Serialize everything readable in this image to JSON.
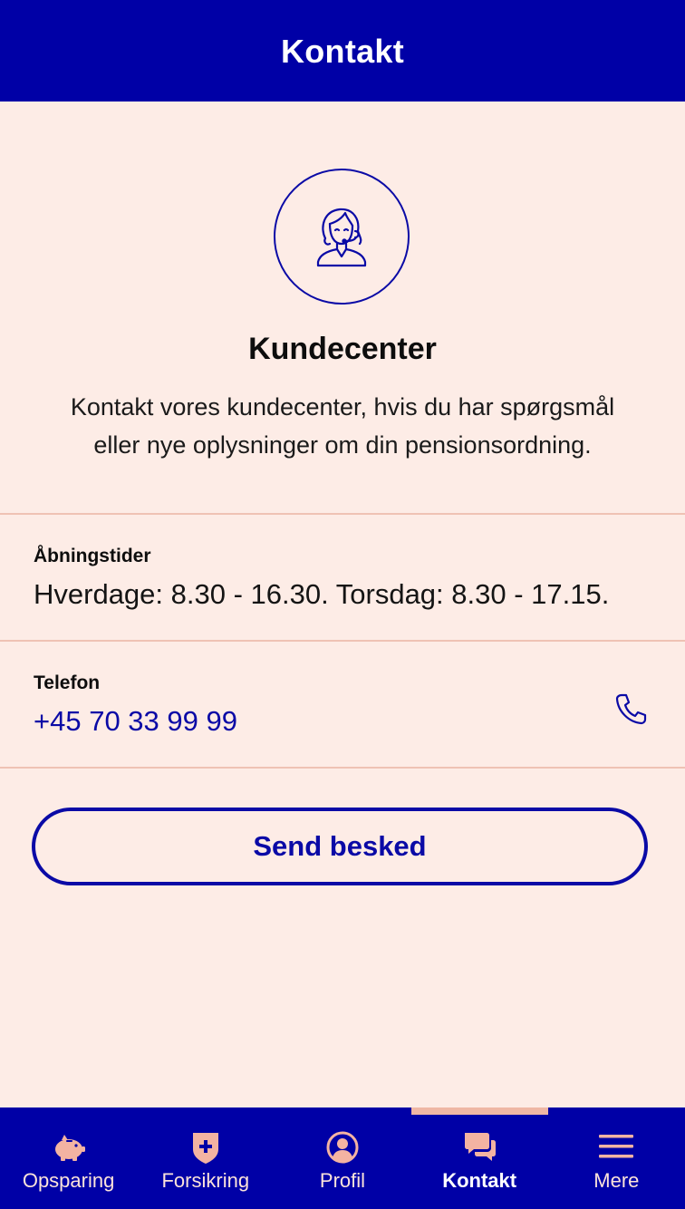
{
  "header": {
    "title": "Kontakt"
  },
  "hero": {
    "icon": "customer-service-agent-icon",
    "title": "Kundecenter",
    "description_line1": "Kontakt vores kundecenter, hvis du har spørgsmål",
    "description_line2": "eller nye oplysninger om din pensionsordning."
  },
  "opening_hours": {
    "label": "Åbningstider",
    "value": "Hverdage: 8.30 - 16.30. Torsdag: 8.30 - 17.15."
  },
  "phone": {
    "label": "Telefon",
    "value": "+45 70 33 99 99",
    "icon": "phone-icon"
  },
  "send_button": {
    "label": "Send besked"
  },
  "nav": {
    "items": [
      {
        "label": "Opsparing",
        "icon": "piggy-bank-icon",
        "active": false
      },
      {
        "label": "Forsikring",
        "icon": "shield-plus-icon",
        "active": false
      },
      {
        "label": "Profil",
        "icon": "profile-icon",
        "active": false
      },
      {
        "label": "Kontakt",
        "icon": "chat-bubbles-icon",
        "active": true
      },
      {
        "label": "Mere",
        "icon": "hamburger-menu-icon",
        "active": false
      }
    ]
  },
  "colors": {
    "brand_blue": "#0000a6",
    "background": "#fdece6",
    "divider": "#efc2b4",
    "accent_peach": "#efb7a5"
  }
}
